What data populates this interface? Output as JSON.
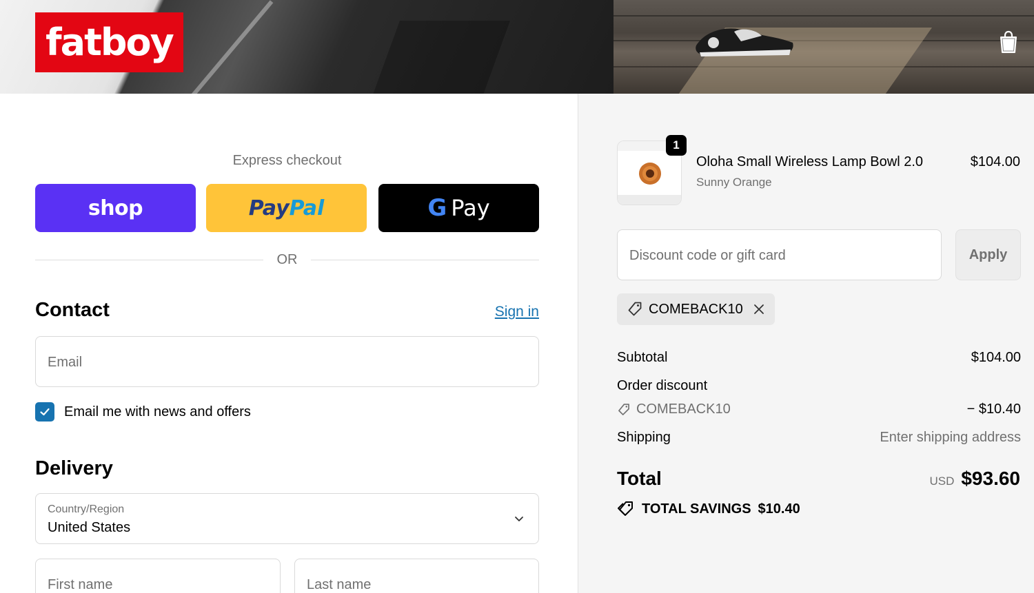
{
  "header": {
    "logo_text": "fatboy",
    "brand_color": "#e30613"
  },
  "express": {
    "title": "Express checkout",
    "shop_label": "shop",
    "paypal_part1": "Pay",
    "paypal_part2": "Pal",
    "gpay_g": "G",
    "gpay_label": "Pay",
    "or_label": "OR"
  },
  "contact": {
    "title": "Contact",
    "sign_in": "Sign in",
    "email_placeholder": "Email",
    "newsletter_label": "Email me with news and offers",
    "newsletter_checked": true
  },
  "delivery": {
    "title": "Delivery",
    "country_label": "Country/Region",
    "country_value": "United States",
    "first_name_placeholder": "First name",
    "last_name_placeholder": "Last name"
  },
  "order": {
    "item": {
      "quantity": "1",
      "name": "Oloha Small Wireless Lamp Bowl 2.0",
      "variant": "Sunny Orange",
      "price": "$104.00"
    },
    "discount_placeholder": "Discount code or gift card",
    "apply_label": "Apply",
    "applied_code": "COMEBACK10",
    "summary": {
      "subtotal_label": "Subtotal",
      "subtotal_value": "$104.00",
      "order_discount_label": "Order discount",
      "discount_code": "COMEBACK10",
      "discount_value": "− $10.40",
      "shipping_label": "Shipping",
      "shipping_value": "Enter shipping address",
      "total_label": "Total",
      "currency": "USD",
      "total_value": "$93.60",
      "savings_label": "TOTAL SAVINGS",
      "savings_value": "$10.40"
    }
  },
  "colors": {
    "accent": "#1773b0",
    "shop_pay": "#5a31f4",
    "paypal": "#ffc439"
  }
}
